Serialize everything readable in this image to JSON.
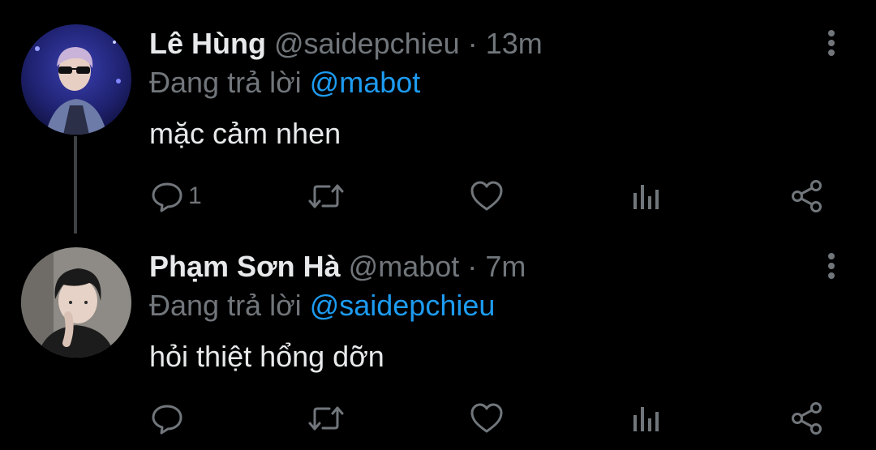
{
  "tweets": [
    {
      "name": "Lê Hùng",
      "handle": "@saidepchieu",
      "separator": "·",
      "time": "13m",
      "replying_prefix": "Đang trả lời",
      "replying_to": "@mabot",
      "text": "mặc cảm nhen",
      "reply_count": "1"
    },
    {
      "name": "Phạm Sơn Hà",
      "handle": "@mabot",
      "separator": "·",
      "time": "7m",
      "replying_prefix": "Đang trả lời",
      "replying_to": "@saidepchieu",
      "text": "hỏi thiệt hổng dỡn",
      "reply_count": ""
    }
  ],
  "icons": {
    "reply": "reply-icon",
    "retweet": "retweet-icon",
    "like": "heart-icon",
    "views": "views-icon",
    "share": "share-icon",
    "more": "more-vertical-icon"
  },
  "colors": {
    "background": "#000000",
    "primary_text": "#e7e9ea",
    "secondary_text": "#71767b",
    "link": "#1d9bf0",
    "thread_line": "#3e4144"
  }
}
